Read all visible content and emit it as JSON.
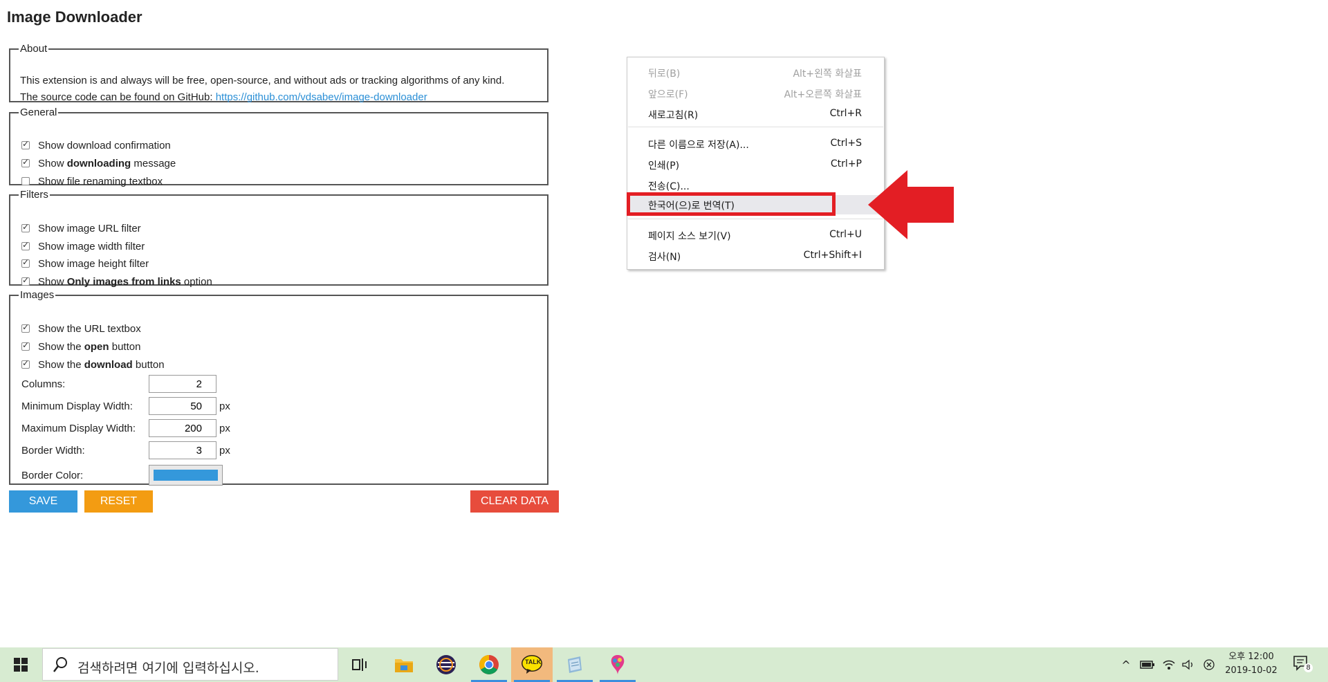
{
  "app": {
    "title": "Image Downloader",
    "about": {
      "legend": "About",
      "line1": "This extension is and always will be free, open-source, and without ads or tracking algorithms of any kind.",
      "line2_prefix": "The source code can be found on GitHub: ",
      "link": "https://github.com/vdsabev/image-downloader"
    },
    "general": {
      "legend": "General",
      "items": [
        {
          "pre": "Show download confirmation",
          "bold": "",
          "post": "",
          "checked": true
        },
        {
          "pre": "Show ",
          "bold": "downloading",
          "post": " message",
          "checked": true
        },
        {
          "pre": "Show file renaming textbox",
          "bold": "",
          "post": "",
          "checked": false
        }
      ]
    },
    "filters": {
      "legend": "Filters",
      "items": [
        {
          "pre": "Show image URL filter",
          "bold": "",
          "post": "",
          "checked": true
        },
        {
          "pre": "Show image width filter",
          "bold": "",
          "post": "",
          "checked": true
        },
        {
          "pre": "Show image height filter",
          "bold": "",
          "post": "",
          "checked": true
        },
        {
          "pre": "Show ",
          "bold": "Only images from links",
          "post": " option",
          "checked": true
        }
      ]
    },
    "images": {
      "legend": "Images",
      "items": [
        {
          "pre": "Show the URL textbox",
          "bold": "",
          "post": "",
          "checked": true
        },
        {
          "pre": "Show the ",
          "bold": "open",
          "post": " button",
          "checked": true
        },
        {
          "pre": "Show the ",
          "bold": "download",
          "post": " button",
          "checked": true
        }
      ],
      "columns": {
        "label": "Columns:",
        "value": "2",
        "unit": ""
      },
      "min_width": {
        "label": "Minimum Display Width:",
        "value": "50",
        "unit": "px"
      },
      "max_width": {
        "label": "Maximum Display Width:",
        "value": "200",
        "unit": "px"
      },
      "border_width": {
        "label": "Border Width:",
        "value": "3",
        "unit": "px"
      },
      "border_color": {
        "label": "Border Color:",
        "value": "#3498db"
      }
    },
    "buttons": {
      "save": "SAVE",
      "reset": "RESET",
      "clear": "CLEAR DATA"
    }
  },
  "context_menu": {
    "items": [
      {
        "label": "뒤로(B)",
        "shortcut": "Alt+왼쪽 화살표",
        "enabled": false
      },
      {
        "label": "앞으로(F)",
        "shortcut": "Alt+오른쪽 화살표",
        "enabled": false
      },
      {
        "label": "새로고침(R)",
        "shortcut": "Ctrl+R",
        "enabled": true
      },
      {
        "label": "다른 이름으로 저장(A)...",
        "shortcut": "Ctrl+S",
        "enabled": true
      },
      {
        "label": "인쇄(P)",
        "shortcut": "Ctrl+P",
        "enabled": true
      },
      {
        "label": "전송(C)...",
        "shortcut": "",
        "enabled": true
      },
      {
        "label": "한국어(으)로 번역(T)",
        "shortcut": "",
        "enabled": true,
        "highlighted": true
      },
      {
        "label": "페이지 소스 보기(V)",
        "shortcut": "Ctrl+U",
        "enabled": true
      },
      {
        "label": "검사(N)",
        "shortcut": "Ctrl+Shift+I",
        "enabled": true
      }
    ],
    "highlight_color": "#e31e24"
  },
  "taskbar": {
    "search_placeholder": "검색하려면 여기에 입력하십시오.",
    "apps": [
      "task-view-icon",
      "file-explorer-icon",
      "eclipse-icon",
      "chrome-icon",
      "kakaotalk-icon",
      "notepad-icon",
      "paint-icon"
    ],
    "kakao_label": "TALK",
    "clock_time": "오후 12:00",
    "clock_date": "2019-10-02",
    "notification_count": "8"
  }
}
